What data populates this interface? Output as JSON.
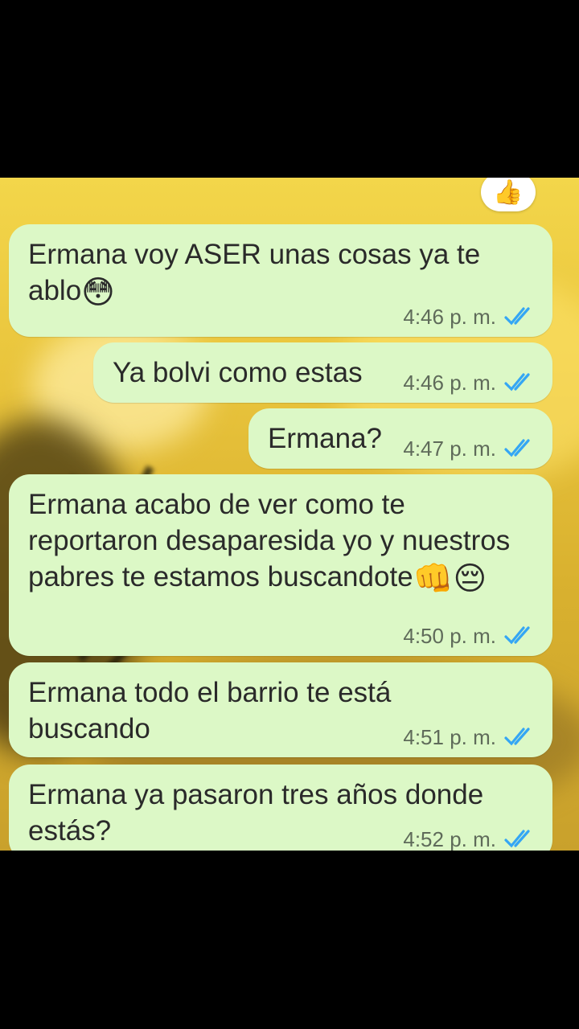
{
  "reaction": "👍",
  "colors": {
    "bubble": "#dcf8c6",
    "tick_read": "#34a6f4",
    "time": "#5f6b5a"
  },
  "messages": [
    {
      "text": "Ermana voy ASER unas cosas ya te ablo",
      "emoji": "😳",
      "time": "4:46 p. m.",
      "status_icon": "double-check-read-icon"
    },
    {
      "text": "Ya bolvi como estas",
      "emoji": "",
      "time": "4:46 p. m.",
      "status_icon": "double-check-read-icon"
    },
    {
      "text": "Ermana?",
      "emoji": "",
      "time": "4:47 p. m.",
      "status_icon": "double-check-read-icon"
    },
    {
      "text": "Ermana acabo de ver como te reportaron desaparesida yo y nuestros pabres te estamos buscandote",
      "emoji": "👊😔",
      "time": "4:50 p. m.",
      "status_icon": "double-check-read-icon"
    },
    {
      "text": "Ermana todo el barrio te está buscando",
      "emoji": "",
      "time": "4:51 p. m.",
      "status_icon": "double-check-read-icon"
    },
    {
      "text": "Ermana ya pasaron tres años donde estás?",
      "emoji": "",
      "time": "4:52 p. m.",
      "status_icon": "double-check-read-icon"
    }
  ]
}
